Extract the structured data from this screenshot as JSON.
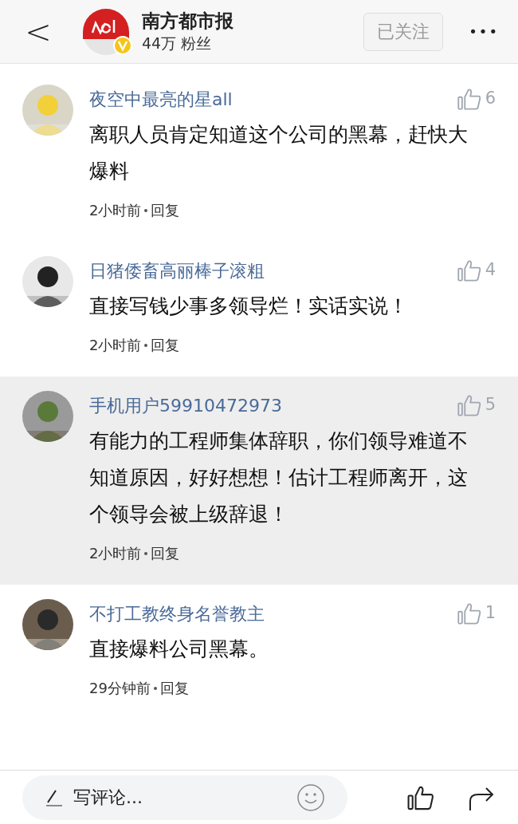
{
  "header": {
    "back": "<",
    "account_name": "南方都市报",
    "followers": "44万 粉丝",
    "verified": true,
    "follow_button": "已关注",
    "more": "•••"
  },
  "comments": [
    {
      "user": "夜空中最亮的星all",
      "likes": "6",
      "text": "离职人员肯定知道这个公司的黑幕，赶快大爆料",
      "time": "2小时前",
      "reply": "回复",
      "highlighted": false
    },
    {
      "user": "日猪倭畜高丽棒子滚粗",
      "likes": "4",
      "text": "直接写钱少事多领导烂！实话实说！",
      "time": "2小时前",
      "reply": "回复",
      "highlighted": false
    },
    {
      "user": "手机用户59910472973",
      "likes": "5",
      "text": "有能力的工程师集体辞职，你们领导难道不知道原因，好好想想！估计工程师离开，这个领导会被上级辞退！",
      "time": "2小时前",
      "reply": "回复",
      "highlighted": true
    },
    {
      "user": "不打工教终身名誉教主",
      "likes": "1",
      "text": "直接爆料公司黑幕。",
      "time": "29分钟前",
      "reply": "回复",
      "highlighted": false
    }
  ],
  "composer": {
    "placeholder": "写评论..."
  }
}
